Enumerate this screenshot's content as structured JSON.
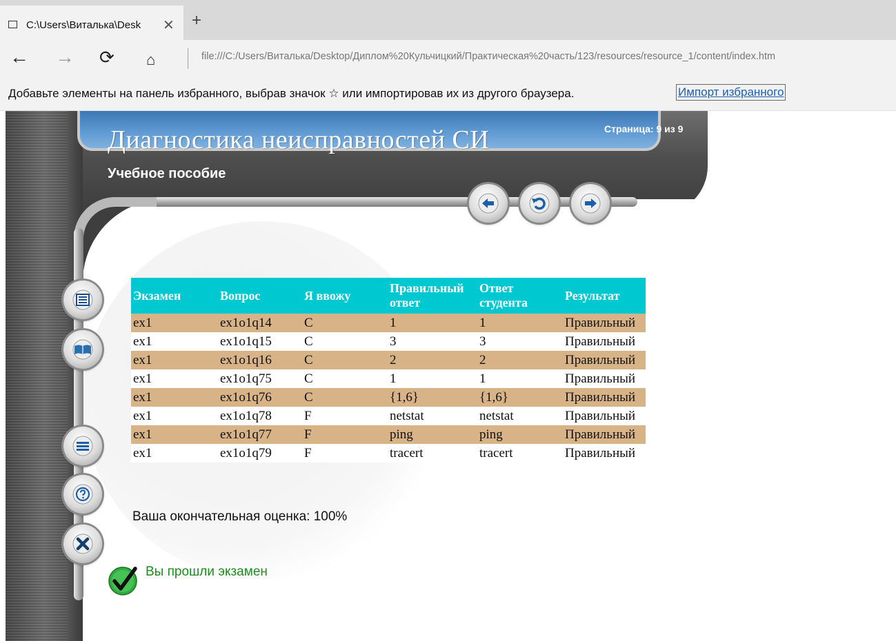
{
  "browser": {
    "tab_title": "C:\\Users\\Виталька\\Desk",
    "tab_close": "✕",
    "new_tab": "+",
    "nav": {
      "back": "←",
      "forward": "→",
      "refresh": "⟳",
      "home": "⌂"
    },
    "address": "file:///C:/Users/Виталька/Desktop/Диплом%20Кульчицкий/Практическая%20часть/123/resources/resource_1/content/index.htm",
    "favorites_hint": "Добавьте элементы на панель избранного, выбрав значок ☆ или импортировав их из другого браузера.",
    "favorites_import": "Импорт избранного"
  },
  "course": {
    "title": "Диагностика неисправностей СИ",
    "subtitle": "Учебное пособие",
    "page_counter": "Страница: 9 из 9"
  },
  "icons": {
    "nav_prev": "arrow-left-icon",
    "nav_reload": "reload-icon",
    "nav_next": "arrow-right-icon",
    "sidebar": [
      "contents-icon",
      "book-icon",
      "menu-icon",
      "help-icon",
      "close-icon"
    ],
    "pass": "checkmark-icon"
  },
  "colors": {
    "banner": "#5f99d2",
    "table_header": "#00c8d0",
    "row_alt": "#d7b387",
    "pass_green": "#1f8a1f"
  },
  "results": {
    "headers": [
      "Экзамен",
      "Вопрос",
      "Я ввожу",
      "Правильный ответ",
      "Ответ студента",
      "Результат"
    ],
    "rows": [
      [
        "ex1",
        "ex1o1q14",
        "C",
        "1",
        "1",
        "Правильный"
      ],
      [
        "ex1",
        "ex1o1q15",
        "C",
        "3",
        "3",
        "Правильный"
      ],
      [
        "ex1",
        "ex1o1q16",
        "C",
        "2",
        "2",
        "Правильный"
      ],
      [
        "ex1",
        "ex1o1q75",
        "C",
        "1",
        "1",
        "Правильный"
      ],
      [
        "ex1",
        "ex1o1q76",
        "C",
        "{1,6}",
        "{1,6}",
        "Правильный"
      ],
      [
        "ex1",
        "ex1o1q78",
        "F",
        "netstat",
        "netstat",
        "Правильный"
      ],
      [
        "ex1",
        "ex1o1q77",
        "F",
        "ping",
        "ping",
        "Правильный"
      ],
      [
        "ex1",
        "ex1o1q79",
        "F",
        "tracert",
        "tracert",
        "Правильный"
      ]
    ]
  },
  "final_grade": "Ваша окончательная оценка: 100%",
  "pass_message": "Вы прошли экзамен"
}
